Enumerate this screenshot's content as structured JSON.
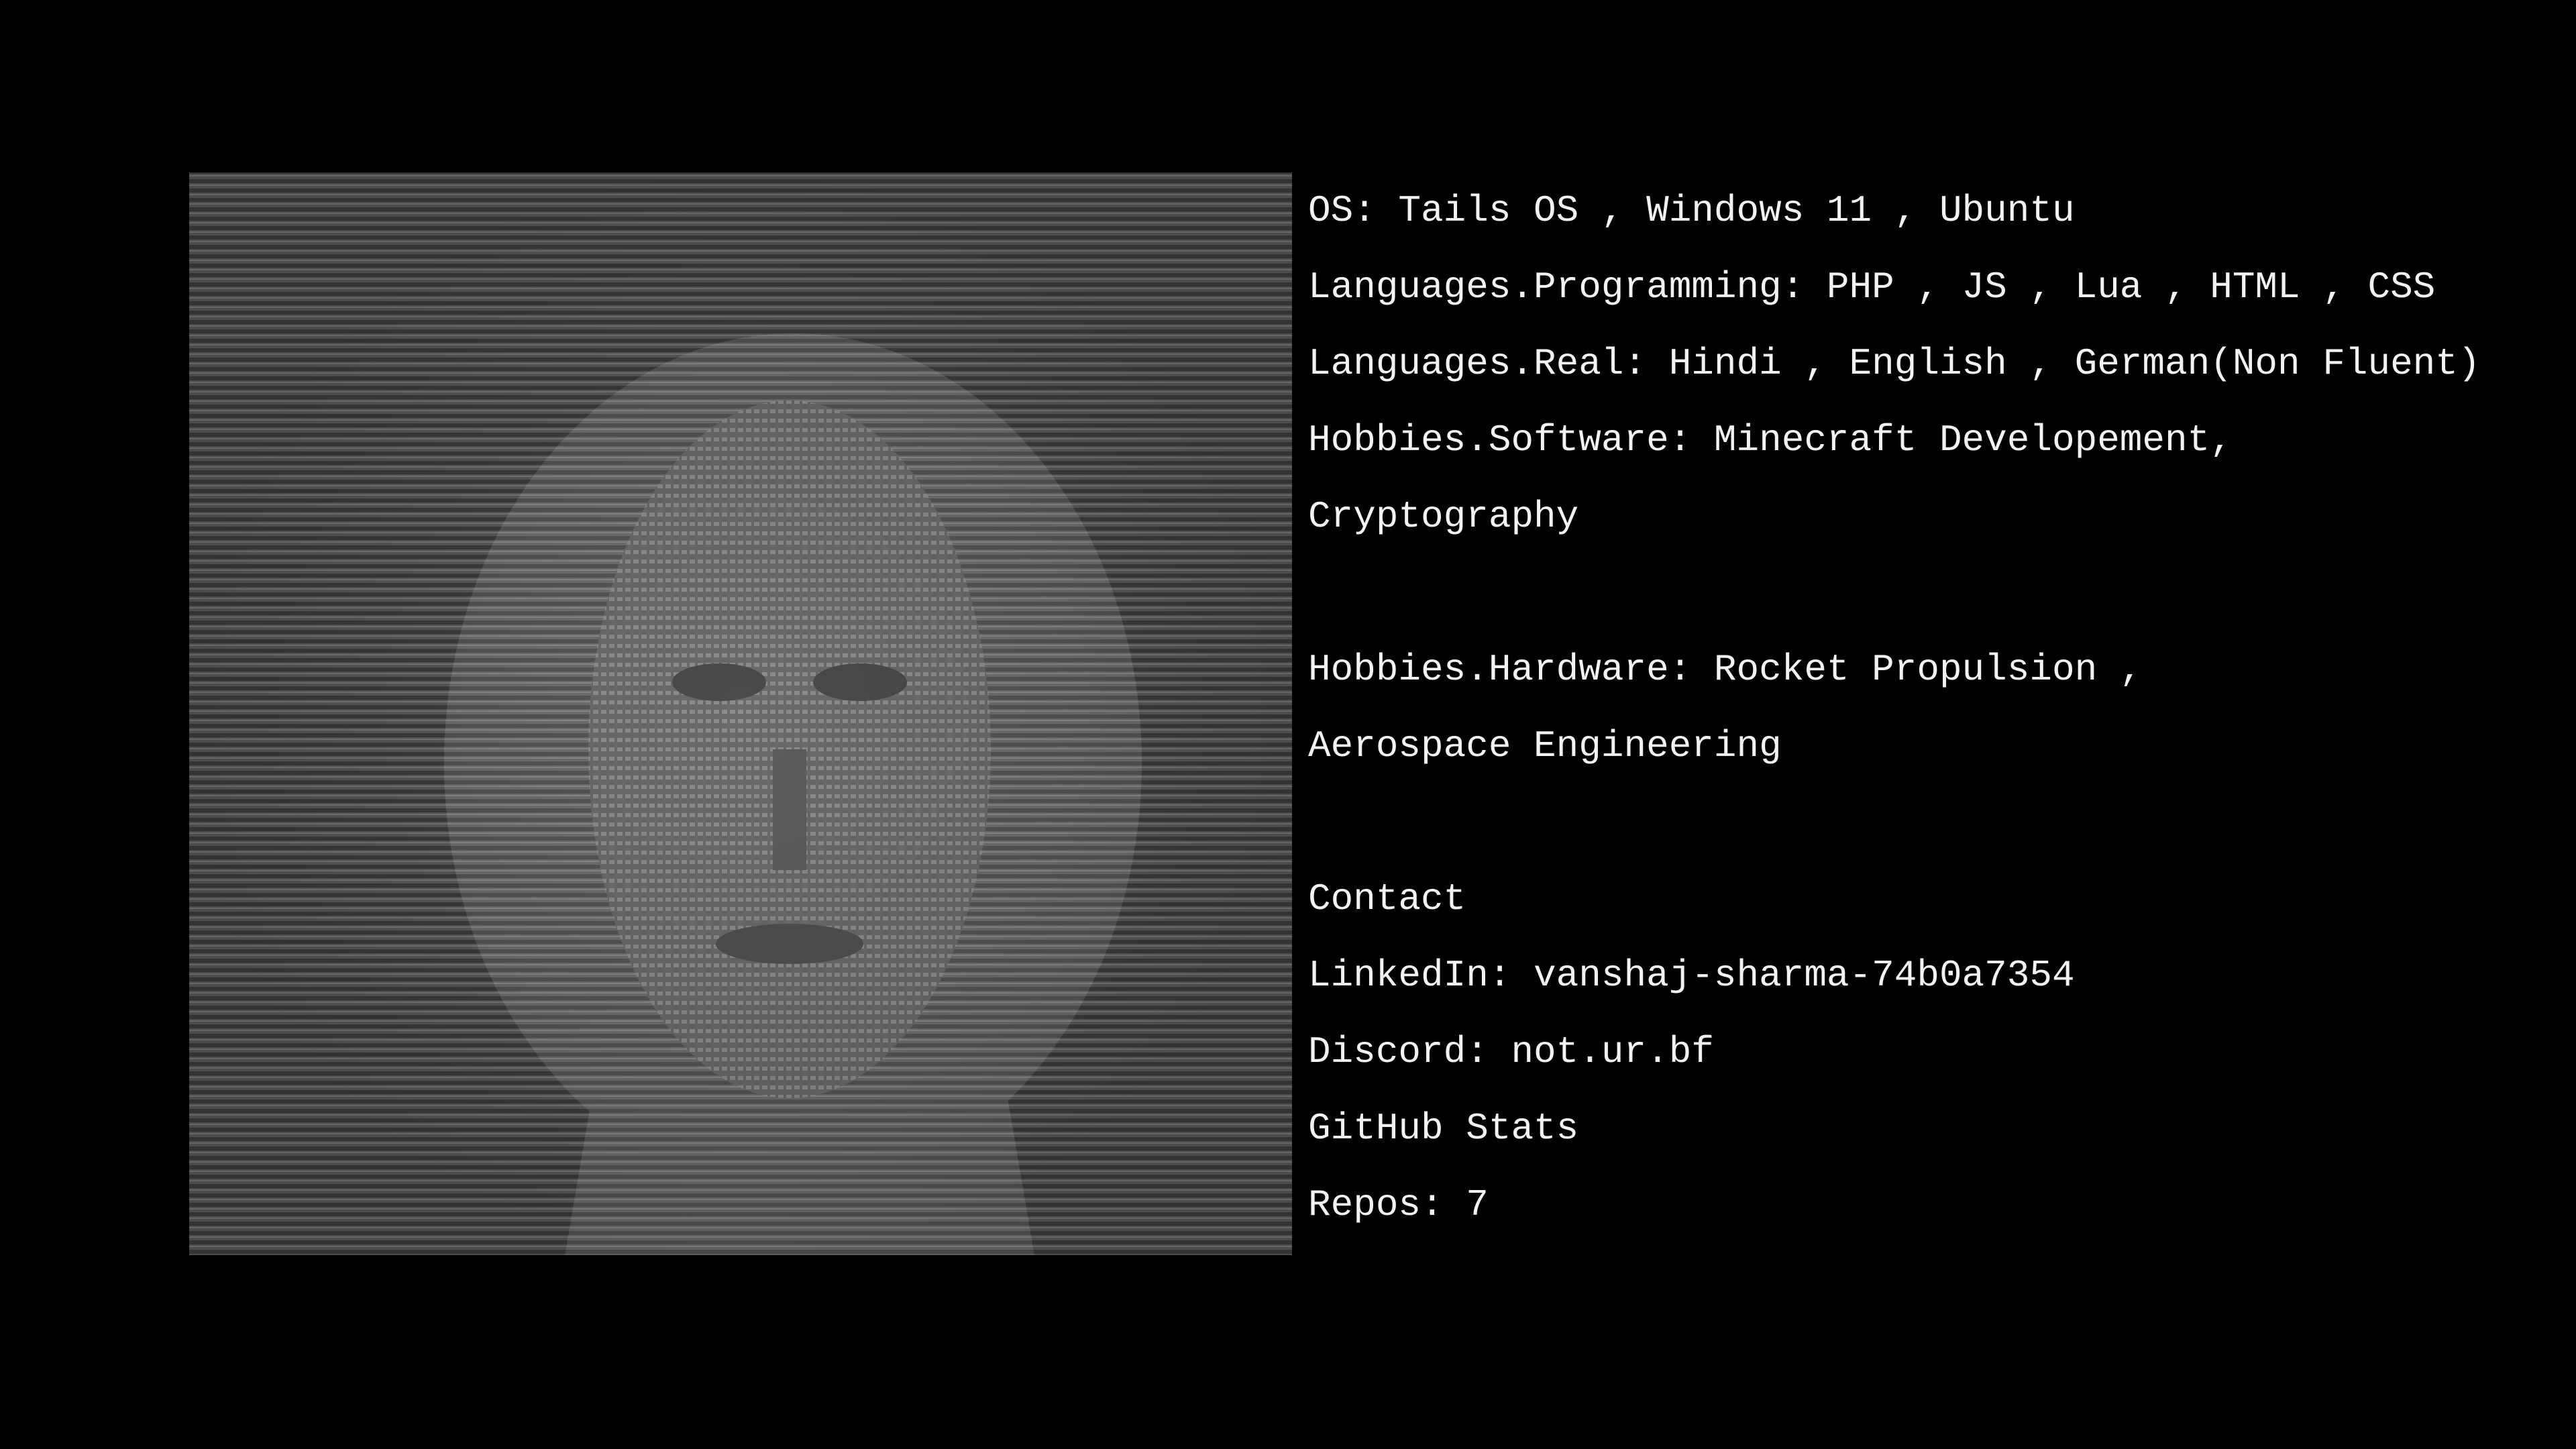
{
  "portrait": {
    "description_icon": "ascii-art-portrait"
  },
  "info": {
    "lines": [
      "OS: Tails OS , Windows 11 , Ubuntu",
      "Languages.Programming: PHP , JS , Lua , HTML , CSS",
      "Languages.Real: Hindi , English , German(Non Fluent)",
      "Hobbies.Software: Minecraft Developement,",
      "Cryptography",
      "",
      "Hobbies.Hardware: Rocket Propulsion ,",
      "Aerospace Engineering",
      "",
      "Contact",
      "LinkedIn: vanshaj-sharma-74b0a7354",
      "Discord: not.ur.bf",
      "GitHub Stats",
      "Repos: 7"
    ]
  },
  "colors": {
    "background": "#000000",
    "text": "#f2f2f2",
    "ascii_dark": "#3a3a3a",
    "ascii_light": "#7a7a7a"
  }
}
